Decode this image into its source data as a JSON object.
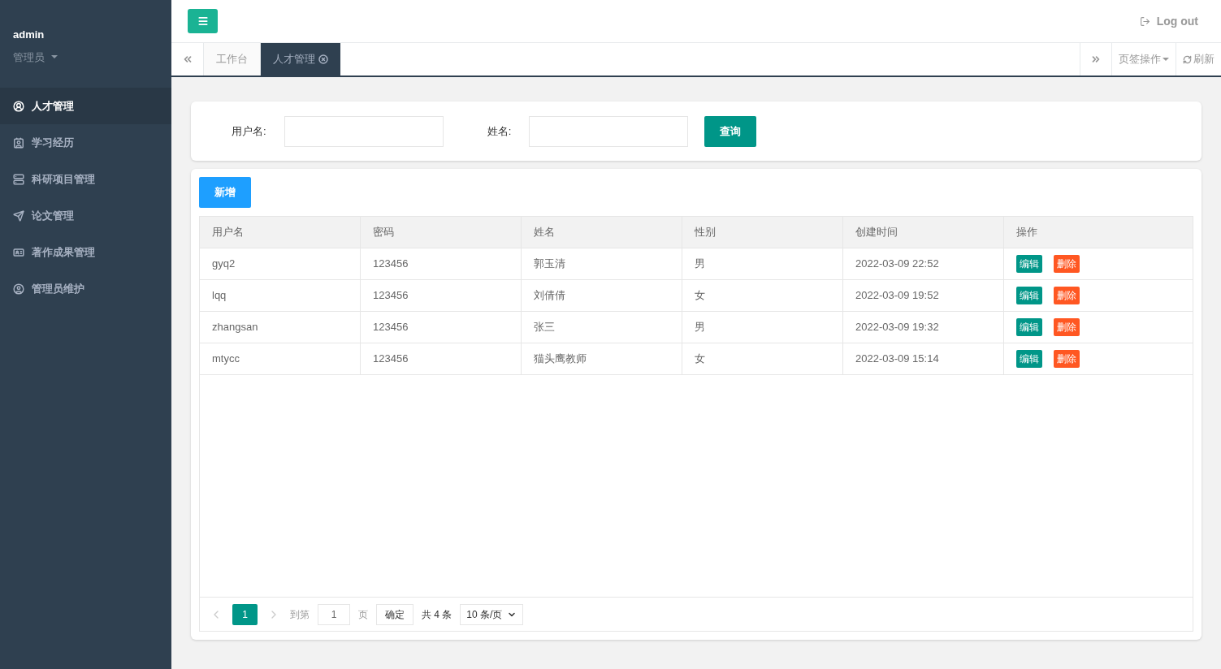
{
  "user": {
    "name": "admin",
    "role": "管理员"
  },
  "sidebar": {
    "items": [
      {
        "label": "人才管理",
        "selected": true
      },
      {
        "label": "学习经历",
        "selected": false
      },
      {
        "label": "科研项目管理",
        "selected": false
      },
      {
        "label": "论文管理",
        "selected": false
      },
      {
        "label": "著作成果管理",
        "selected": false
      },
      {
        "label": "管理员维护",
        "selected": false
      }
    ]
  },
  "header": {
    "logout": "Log out"
  },
  "tabs": [
    {
      "label": "工作台",
      "selected": false,
      "closable": false
    },
    {
      "label": "人才管理",
      "selected": true,
      "closable": true
    }
  ],
  "tab_tools": {
    "page_ops": "页签操作",
    "refresh": "刷新"
  },
  "search": {
    "fields": [
      {
        "label": "用户名:"
      },
      {
        "label": "姓名:"
      }
    ],
    "button": "查询"
  },
  "add_button": "新增",
  "table": {
    "columns": [
      "用户名",
      "密码",
      "姓名",
      "性别",
      "创建时间",
      "操作"
    ],
    "rows": [
      {
        "cells": [
          "gyq2",
          "123456",
          "郭玉清",
          "男",
          "2022-03-09 22:52"
        ],
        "actions": [
          "编辑",
          "删除"
        ]
      },
      {
        "cells": [
          "lqq",
          "123456",
          "刘倩倩",
          "女",
          "2022-03-09 19:52"
        ],
        "actions": [
          "编辑",
          "删除"
        ]
      },
      {
        "cells": [
          "zhangsan",
          "123456",
          "张三",
          "男",
          "2022-03-09 19:32"
        ],
        "actions": [
          "编辑",
          "删除"
        ]
      },
      {
        "cells": [
          "mtycc",
          "123456",
          "猫头鹰教师",
          "女",
          "2022-03-09 15:14"
        ],
        "actions": [
          "编辑",
          "删除"
        ]
      }
    ]
  },
  "pagination": {
    "pages": [
      {
        "label": "1",
        "selected": true
      }
    ],
    "goto": "到第",
    "page_input": "1",
    "page_unit": "页",
    "confirm": "确定",
    "total": "共 4 条",
    "page_size": "10 条/页"
  }
}
